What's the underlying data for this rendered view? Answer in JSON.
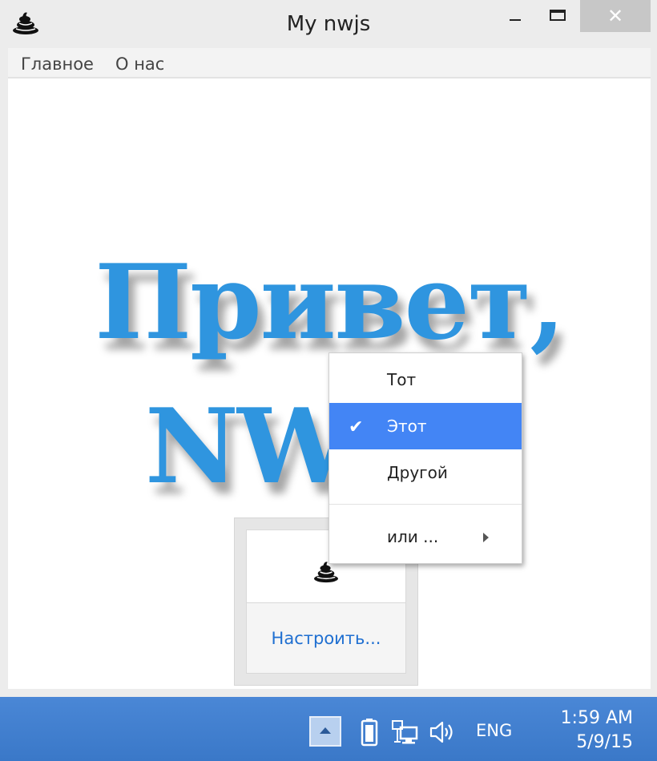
{
  "window": {
    "title": "My nwjs",
    "app_icon": "pile-icon",
    "controls": {
      "minimize_icon": "minimize-icon",
      "maximize_icon": "maximize-icon",
      "close_label": "✕"
    }
  },
  "menubar": {
    "items": [
      {
        "label": "Главное"
      },
      {
        "label": "О нас"
      }
    ]
  },
  "main": {
    "heading_line1": "Привет,",
    "heading_line2": "NWJS!",
    "heading_color": "#2f95df"
  },
  "tray_popup": {
    "icon": "pile-icon",
    "customize_label": "Настроить..."
  },
  "context_menu": {
    "items": [
      {
        "label": "Тот",
        "checked": false
      },
      {
        "label": "Этот",
        "checked": true,
        "highlighted": true
      },
      {
        "label": "Другой",
        "checked": false
      }
    ],
    "submenu_item": {
      "label": "или ...",
      "icon": "chevron-right-icon"
    },
    "highlight_color": "#4385f5"
  },
  "taskbar": {
    "color": "#3f7fd0",
    "tray_icons": [
      "show-hidden-icons-icon",
      "battery-icon",
      "network-icon",
      "volume-icon"
    ],
    "language": "ENG",
    "clock": {
      "time": "1:59 AM",
      "date": "5/9/15"
    }
  }
}
